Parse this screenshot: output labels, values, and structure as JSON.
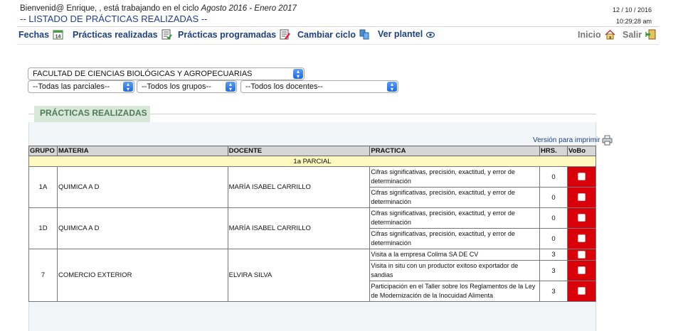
{
  "header": {
    "greeting_prefix": "Bienvenid@ Enrique, , está trabajando en el ciclo",
    "cycle": "Agosto 2016 - Enero 2017",
    "title": "-- LISTADO DE PRÁCTICAS REALIZADAS --",
    "date": "12 / 10 / 2016",
    "time": "10:29:28 am"
  },
  "nav": {
    "items": [
      {
        "label": "Fechas",
        "icon": "calendar-icon"
      },
      {
        "label": "Prácticas realizadas",
        "icon": "checklist-icon"
      },
      {
        "label": "Prácticas programadas",
        "icon": "edit-list-icon"
      },
      {
        "label": "Cambiar ciclo",
        "icon": "cycle-icon"
      },
      {
        "label": "Ver plantel",
        "icon": "eye-icon"
      }
    ],
    "inicio": "Inicio",
    "salir": "Salir"
  },
  "filters": {
    "faculty": "FACULTAD DE CIENCIAS BIOLÓGICAS Y AGROPECUARIAS",
    "parcial": "--Todas las parciales--",
    "grupo": "--Todos los grupos--",
    "docente": "--Todos los docentes--"
  },
  "panel": {
    "title": "PRÁCTICAS REALIZADAS",
    "print_label": "Versión para imprimir"
  },
  "table": {
    "headers": [
      "GRUPO",
      "MATERIA",
      "DOCENTE",
      "PRACTICA",
      "HRS.",
      "VoBo"
    ],
    "parcial_label": "1a PARCIAL",
    "groups": [
      {
        "grupo": "1A",
        "materia": "QUIMICA A D",
        "docente": "MARÍA ISABEL CARRILLO",
        "practicas": [
          {
            "nombre": "Cifras significativas, precisión, exactitud, y error de determinación",
            "hrs": "0"
          },
          {
            "nombre": "Cifras significativas, precisión, exactitud, y error de determinación",
            "hrs": "0"
          }
        ]
      },
      {
        "grupo": "1D",
        "materia": "QUIMICA A D",
        "docente": "MARÍA ISABEL CARRILLO",
        "practicas": [
          {
            "nombre": "Cifras significativas, precisión, exactitud, y error de determinación",
            "hrs": "0"
          },
          {
            "nombre": "Cifras significativas, precisión, exactitud, y error de determinación",
            "hrs": "0"
          }
        ]
      },
      {
        "grupo": "7",
        "materia": "COMERCIO EXTERIOR",
        "docente": "ELVIRA SILVA",
        "practicas": [
          {
            "nombre": "Visita a la empresa Colima SA DE CV",
            "hrs": "3"
          },
          {
            "nombre": "Visita in situ con un productor exitoso exportador de sandias",
            "hrs": "3"
          },
          {
            "nombre": "Participación en el Taller sobre los Reglamentos de la Ley de Modernización de la Inocuidad Alimenta",
            "hrs": "3"
          }
        ]
      }
    ]
  }
}
